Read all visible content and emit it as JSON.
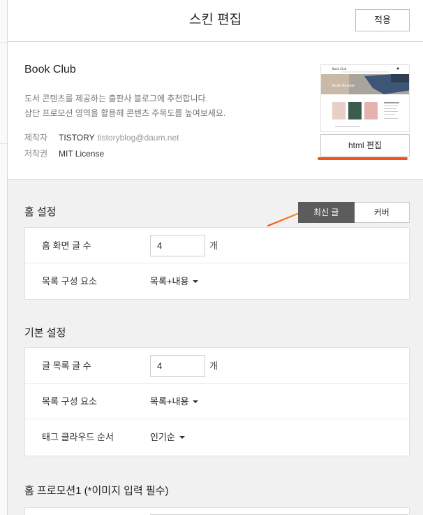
{
  "header": {
    "title": "스킨 편집",
    "apply_label": "적용"
  },
  "skin": {
    "name": "Book Club",
    "description_line1": "도서 콘텐츠를 제공하는 출판사 블로그에 추천합니다.",
    "description_line2": "상단 프로모션 영역을 활용해 콘텐츠 주목도를 높여보세요.",
    "maker_label": "제작자",
    "maker_name": "TISTORY",
    "maker_email": "tistoryblog@daum.net",
    "license_label": "저작권",
    "license_value": "MIT License",
    "html_edit_label": "html 편집",
    "thumbnail": {
      "site_title": "Book Club",
      "banner_text": "Book Review"
    }
  },
  "home_settings": {
    "title": "홈 설정",
    "toggle": {
      "options": [
        "최신 글",
        "커버"
      ],
      "selected": "최신 글"
    },
    "rows": [
      {
        "label": "홈 화면 글 수",
        "value": "4",
        "unit": "개"
      },
      {
        "label": "목록 구성 요소",
        "select": "목록+내용"
      }
    ]
  },
  "basic_settings": {
    "title": "기본 설정",
    "rows": [
      {
        "label": "글 목록 글 수",
        "value": "4",
        "unit": "개"
      },
      {
        "label": "목록 구성 요소",
        "select": "목록+내용"
      },
      {
        "label": "태그 클라우드 순서",
        "select": "인기순"
      }
    ]
  },
  "promotion1": {
    "title": "홈 프로모션1 (*이미지 입력 필수)"
  },
  "colors": {
    "accent_underline": "#f2501e",
    "arrow": "#f7931e",
    "toggle_active": "#5c5c5c"
  }
}
